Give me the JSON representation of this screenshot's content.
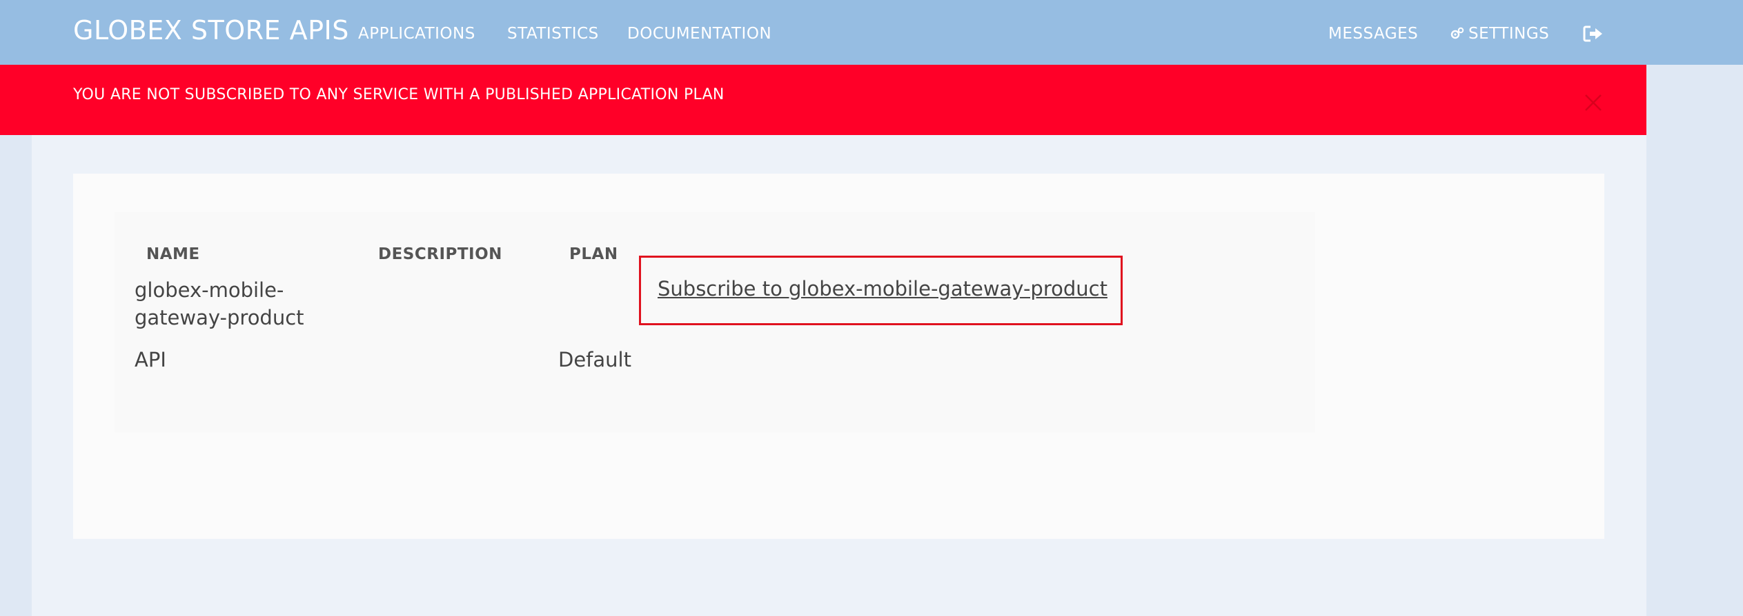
{
  "header": {
    "brand": "GLOBEX STORE APIS",
    "nav": {
      "applications": "APPLICATIONS",
      "statistics": "STATISTICS",
      "documentation": "DOCUMENTATION",
      "messages": "MESSAGES",
      "settings": "SETTINGS"
    },
    "icons": {
      "settings": "gears-icon",
      "logout": "sign-out-icon"
    }
  },
  "alert": {
    "message": "YOU ARE NOT SUBSCRIBED TO ANY SERVICE WITH A PUBLISHED APPLICATION PLAN",
    "close_icon": "close-icon",
    "color": "#ff0028"
  },
  "table": {
    "columns": [
      "NAME",
      "DESCRIPTION",
      "PLAN"
    ],
    "row": {
      "name": "globex-mobile-gateway-product",
      "type": "API",
      "plan": "Default",
      "subscribe_label": "Subscribe to globex-mobile-gateway-product"
    }
  },
  "colors": {
    "navbar": "#96bde2",
    "highlight_border": "#e0121f"
  }
}
